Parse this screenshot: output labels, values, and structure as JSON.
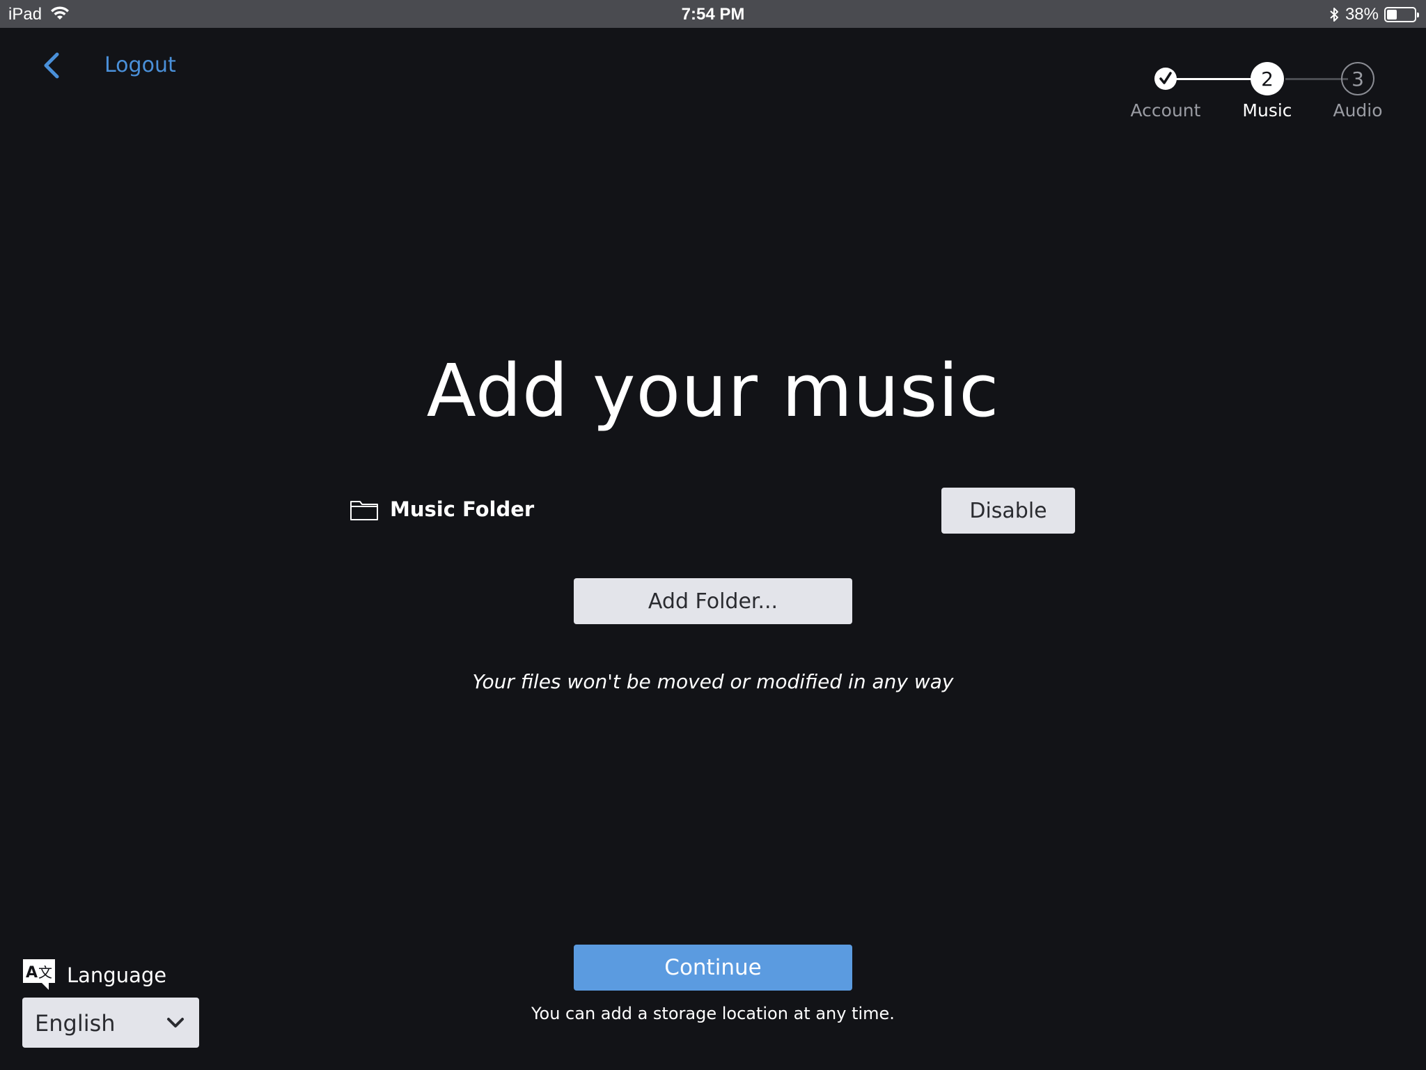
{
  "status_bar": {
    "device": "iPad",
    "time": "7:54 PM",
    "battery": "38%",
    "battery_level": 0.38
  },
  "nav": {
    "back_icon": "chevron-left-icon",
    "logout_label": "Logout"
  },
  "stepper": {
    "steps": [
      {
        "label": "Account",
        "number": "✓",
        "state": "completed"
      },
      {
        "label": "Music",
        "number": "2",
        "state": "current"
      },
      {
        "label": "Audio",
        "number": "3",
        "state": "upcoming"
      }
    ]
  },
  "main": {
    "title": "Add your music",
    "folder": {
      "icon": "folder-icon",
      "label": "Music Folder",
      "disable_label": "Disable"
    },
    "add_folder_label": "Add Folder...",
    "note": "Your files won't be moved or modified in any way"
  },
  "footer": {
    "continue_label": "Continue",
    "footnote": "You can add a storage location at any time."
  },
  "language": {
    "icon": "translate-icon",
    "label": "Language",
    "selected": "English"
  },
  "colors": {
    "background": "#121317",
    "accent": "#5b9be0",
    "link": "#4a90d9",
    "button_light": "#e3e4ea",
    "status_bar": "#4a4b50"
  }
}
